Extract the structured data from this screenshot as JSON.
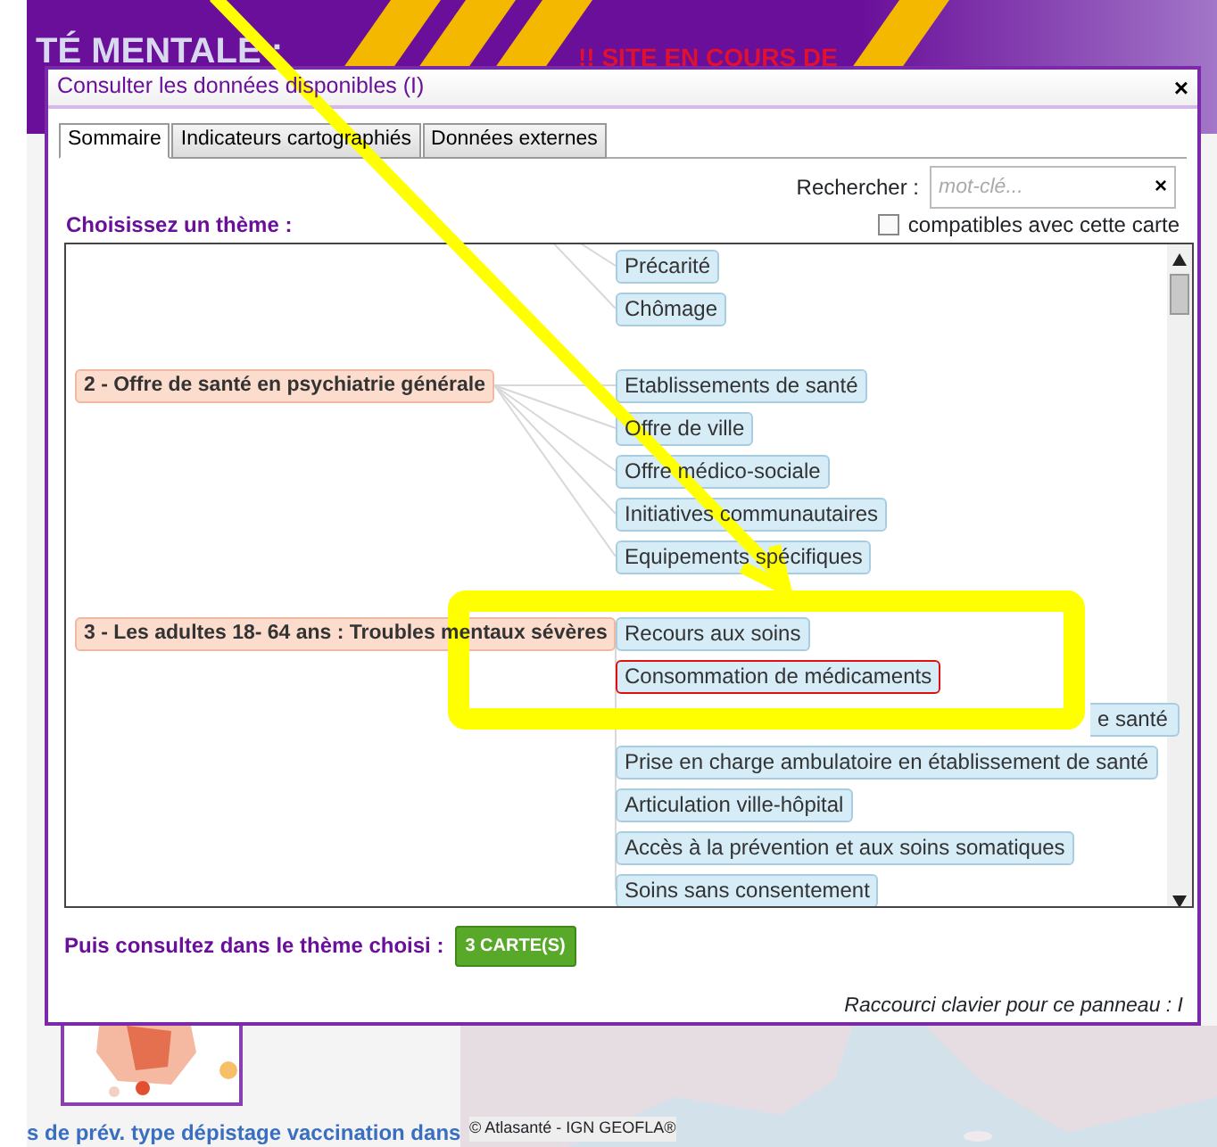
{
  "background": {
    "header_title": "TÉ MENTALE :",
    "banner": "!! SITE EN COURS DE",
    "caption": "s de prév. type dépistage vaccination dans",
    "map_credit": "© Atlasanté - ",
    "map_link": "IGN GEOFLA®"
  },
  "dialog": {
    "title": "Consulter les données disponibles (I)",
    "close": "×",
    "tabs": [
      {
        "label": "Sommaire",
        "selected": true
      },
      {
        "label": "Indicateurs cartographiés",
        "selected": false
      },
      {
        "label": "Données externes",
        "selected": false
      }
    ],
    "search": {
      "label": "Rechercher :",
      "placeholder": "mot-clé...",
      "clear": "×"
    },
    "theme_label": "Choisissez un thème :",
    "compatible": {
      "label": "compatibles avec cette carte",
      "checked": false
    },
    "themes": [
      {
        "children": [
          {
            "label": "Précarité",
            "highlighted": false
          },
          {
            "label": "Chômage",
            "highlighted": false
          }
        ]
      },
      {
        "label": "2 - Offre de santé en psychiatrie générale",
        "children": [
          {
            "label": "Etablissements de santé",
            "highlighted": false
          },
          {
            "label": "Offre de ville",
            "highlighted": false
          },
          {
            "label": "Offre médico-sociale",
            "highlighted": false
          },
          {
            "label": "Initiatives communautaires",
            "highlighted": false
          },
          {
            "label": "Equipements spécifiques",
            "highlighted": false
          }
        ]
      },
      {
        "label": "3 - Les adultes 18- 64 ans : Troubles mentaux sévères",
        "children": [
          {
            "label": "Recours aux soins",
            "highlighted": false
          },
          {
            "label": "Consommation de médicaments",
            "highlighted": true
          },
          {
            "label": "e santé",
            "highlighted": false,
            "covered": true
          },
          {
            "label": "Prise en charge ambulatoire en établissement de santé",
            "highlighted": false
          },
          {
            "label": "Articulation ville-hôpital",
            "highlighted": false
          },
          {
            "label": "Accès à la prévention et aux soins somatiques",
            "highlighted": false
          },
          {
            "label": "Soins sans consentement",
            "highlighted": false
          }
        ]
      }
    ],
    "footer": {
      "label": "Puis consultez dans le thème choisi :",
      "button": "3 CARTE(S)"
    },
    "shortcut": "Raccourci clavier pour ce panneau : I"
  }
}
